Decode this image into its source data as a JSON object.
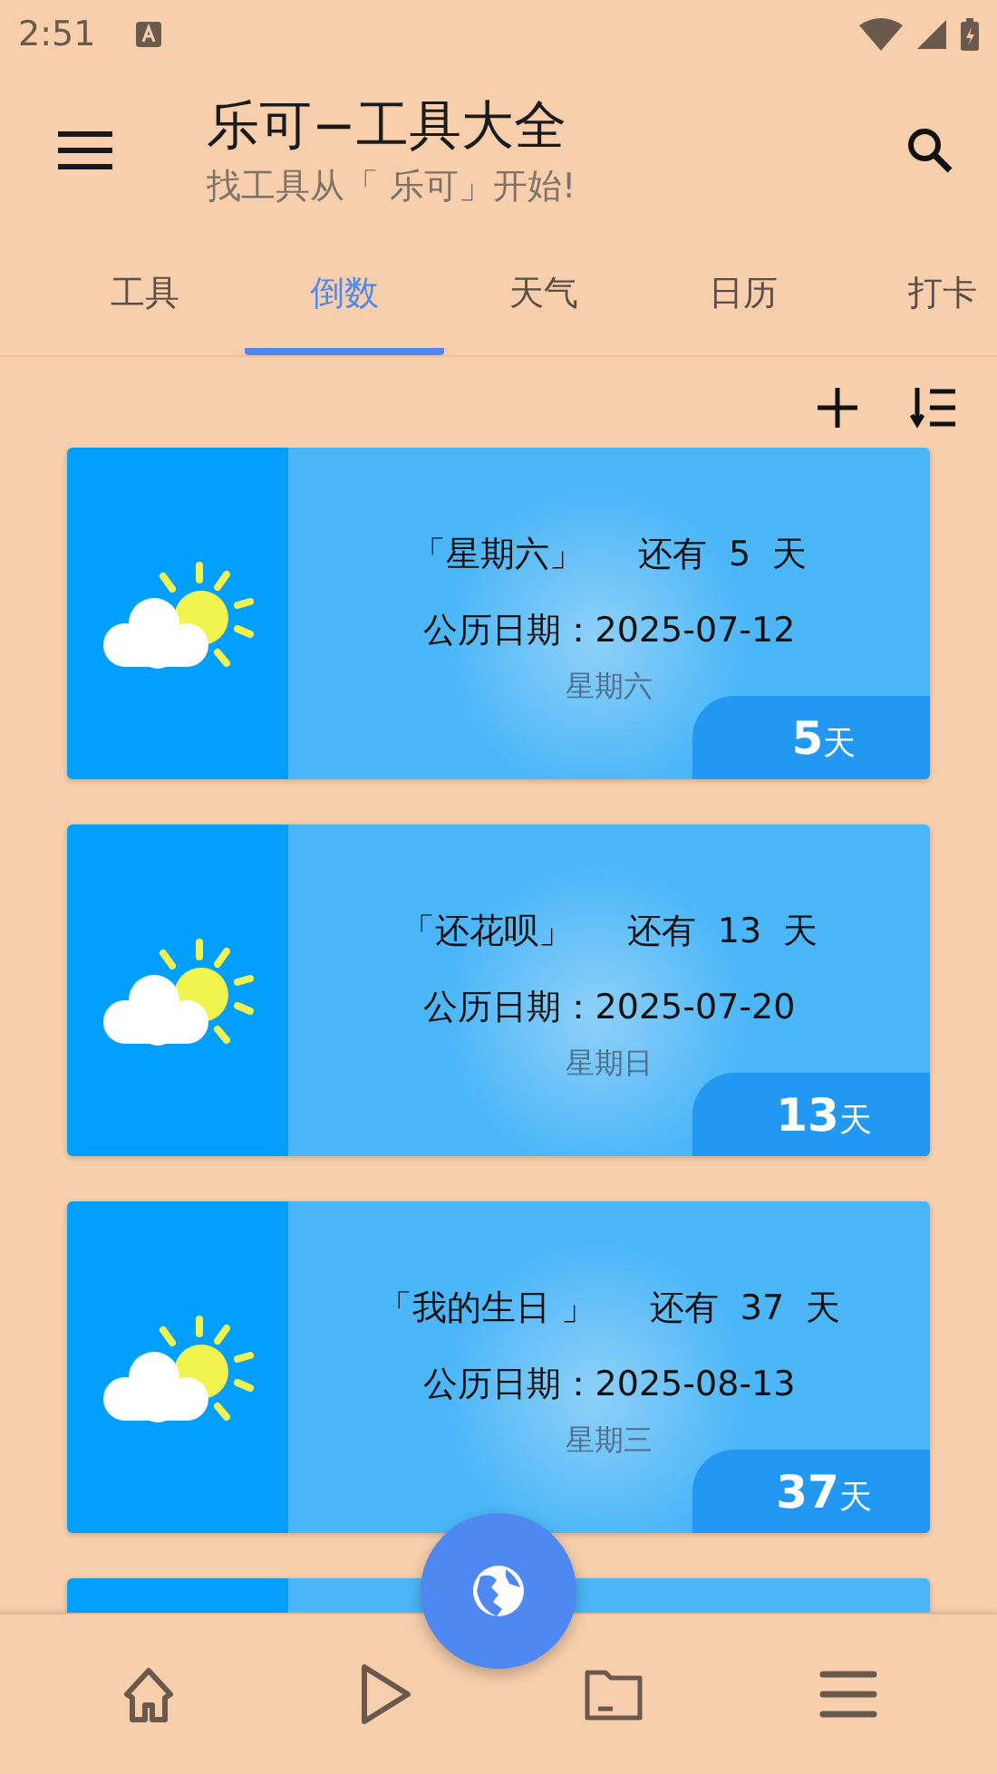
{
  "status_bar": {
    "time": "2:51"
  },
  "app_bar": {
    "title": "乐可−工具大全",
    "subtitle": "找工具从「 乐可」开始!"
  },
  "tabs": [
    {
      "label": "工具",
      "selected": false
    },
    {
      "label": "倒数",
      "selected": true
    },
    {
      "label": "天气",
      "selected": false
    },
    {
      "label": "日历",
      "selected": false
    },
    {
      "label": "打卡",
      "selected": false
    }
  ],
  "events": [
    {
      "name": "「星期六」",
      "remaining": "还有  5  天",
      "date": "公历日期：2025-07-12",
      "weekday": "星期六",
      "days": "5",
      "unit": "天"
    },
    {
      "name": "「还花呗」",
      "remaining": "还有  13  天",
      "date": "公历日期：2025-07-20",
      "weekday": "星期日",
      "days": "13",
      "unit": "天"
    },
    {
      "name": "「我的生日 」",
      "remaining": "还有  37  天",
      "date": "公历日期：2025-08-13",
      "weekday": "星期三",
      "days": "37",
      "unit": "天"
    }
  ]
}
